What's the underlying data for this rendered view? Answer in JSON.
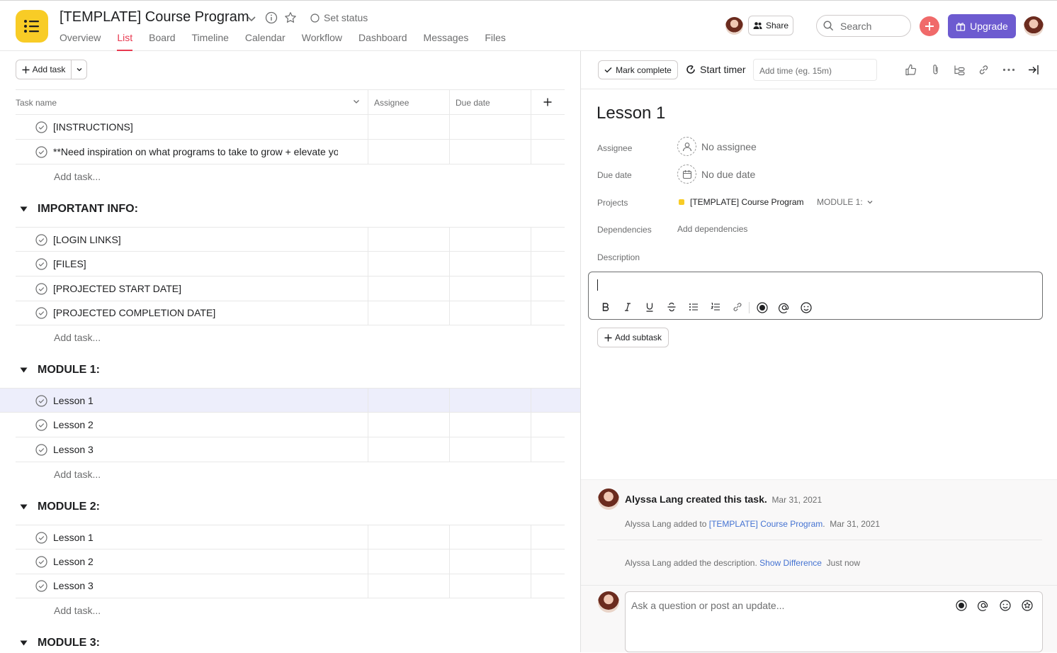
{
  "header": {
    "project_title": "[TEMPLATE] Course Program",
    "set_status": "Set status",
    "tabs": [
      "Overview",
      "List",
      "Board",
      "Timeline",
      "Calendar",
      "Workflow",
      "Dashboard",
      "Messages",
      "Files"
    ],
    "active_tab": "List",
    "share_label": "Share",
    "search_placeholder": "Search",
    "upgrade_label": "Upgrade"
  },
  "list": {
    "add_task_label": "Add task",
    "columns": {
      "task_name": "Task name",
      "assignee": "Assignee",
      "due_date": "Due date"
    },
    "add_task_row": "Add task...",
    "ungrouped": [
      "[INSTRUCTIONS]",
      "**Need inspiration on what programs to take to grow + elevate your"
    ],
    "sections": [
      {
        "name": "IMPORTANT INFO:",
        "tasks": [
          "[LOGIN LINKS]",
          "[FILES]",
          "[PROJECTED START DATE]",
          "[PROJECTED COMPLETION DATE]"
        ]
      },
      {
        "name": "MODULE 1:",
        "tasks": [
          "Lesson 1",
          "Lesson 2",
          "Lesson 3"
        ]
      },
      {
        "name": "MODULE 2:",
        "tasks": [
          "Lesson 1",
          "Lesson 2",
          "Lesson 3"
        ]
      },
      {
        "name": "MODULE 3:",
        "tasks": []
      }
    ]
  },
  "detail": {
    "mark_complete": "Mark complete",
    "start_timer": "Start timer",
    "add_time_placeholder": "Add time (eg. 15m)",
    "title": "Lesson 1",
    "fields": {
      "assignee_label": "Assignee",
      "assignee_value": "No assignee",
      "due_label": "Due date",
      "due_value": "No due date",
      "projects_label": "Projects",
      "project_name": "[TEMPLATE] Course Program",
      "section_name": "MODULE 1:",
      "dependencies_label": "Dependencies",
      "dependencies_value": "Add dependencies",
      "description_label": "Description"
    },
    "add_subtask": "Add subtask",
    "activity": {
      "creator": "Alyssa Lang created this task.",
      "created_date": "Mar 31, 2021",
      "added_prefix": "Alyssa Lang added to",
      "added_project": "[TEMPLATE] Course Program",
      "added_suffix": ".",
      "added_date": "Mar 31, 2021",
      "desc_prefix": "Alyssa Lang added the description.",
      "desc_link": "Show Difference",
      "desc_time": "Just now"
    },
    "comment_placeholder": "Ask a question or post an update..."
  },
  "colors": {
    "accent": "#e8384f",
    "upgrade": "#6d5bd0",
    "add_button": "#f06a6a",
    "project_dot": "#f8cc26",
    "link": "#4573d2",
    "selected_row": "#edeefb"
  }
}
